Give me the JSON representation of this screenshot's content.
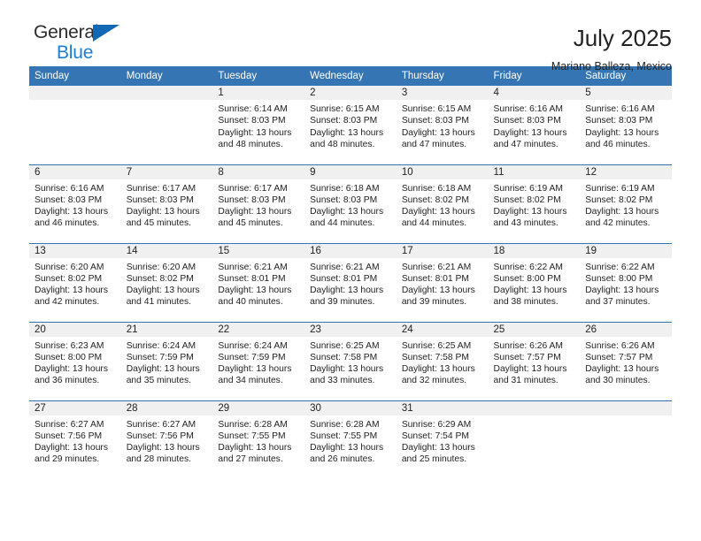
{
  "brand": {
    "name_top": "General",
    "name_bottom": "Blue",
    "triangle_icon": "blue-triangle-icon",
    "color_dark": "#2b2b2b",
    "color_blue": "#1b7fd4"
  },
  "header": {
    "title": "July 2025",
    "subtitle": "Mariano Balleza, Mexico"
  },
  "theme": {
    "header_blue": "#3575b4",
    "daynum_gray": "#f0f0f0",
    "text": "#222222"
  },
  "calendar": {
    "columns": [
      "Sunday",
      "Monday",
      "Tuesday",
      "Wednesday",
      "Thursday",
      "Friday",
      "Saturday"
    ],
    "weeks": [
      [
        {
          "day": "",
          "empty": true,
          "sunrise": "",
          "sunset": "",
          "daylight_1": "",
          "daylight_2": ""
        },
        {
          "day": "",
          "empty": true,
          "sunrise": "",
          "sunset": "",
          "daylight_1": "",
          "daylight_2": ""
        },
        {
          "day": "1",
          "empty": false,
          "sunrise": "Sunrise: 6:14 AM",
          "sunset": "Sunset: 8:03 PM",
          "daylight_1": "Daylight: 13 hours",
          "daylight_2": "and 48 minutes."
        },
        {
          "day": "2",
          "empty": false,
          "sunrise": "Sunrise: 6:15 AM",
          "sunset": "Sunset: 8:03 PM",
          "daylight_1": "Daylight: 13 hours",
          "daylight_2": "and 48 minutes."
        },
        {
          "day": "3",
          "empty": false,
          "sunrise": "Sunrise: 6:15 AM",
          "sunset": "Sunset: 8:03 PM",
          "daylight_1": "Daylight: 13 hours",
          "daylight_2": "and 47 minutes."
        },
        {
          "day": "4",
          "empty": false,
          "sunrise": "Sunrise: 6:16 AM",
          "sunset": "Sunset: 8:03 PM",
          "daylight_1": "Daylight: 13 hours",
          "daylight_2": "and 47 minutes."
        },
        {
          "day": "5",
          "empty": false,
          "sunrise": "Sunrise: 6:16 AM",
          "sunset": "Sunset: 8:03 PM",
          "daylight_1": "Daylight: 13 hours",
          "daylight_2": "and 46 minutes."
        }
      ],
      [
        {
          "day": "6",
          "empty": false,
          "sunrise": "Sunrise: 6:16 AM",
          "sunset": "Sunset: 8:03 PM",
          "daylight_1": "Daylight: 13 hours",
          "daylight_2": "and 46 minutes."
        },
        {
          "day": "7",
          "empty": false,
          "sunrise": "Sunrise: 6:17 AM",
          "sunset": "Sunset: 8:03 PM",
          "daylight_1": "Daylight: 13 hours",
          "daylight_2": "and 45 minutes."
        },
        {
          "day": "8",
          "empty": false,
          "sunrise": "Sunrise: 6:17 AM",
          "sunset": "Sunset: 8:03 PM",
          "daylight_1": "Daylight: 13 hours",
          "daylight_2": "and 45 minutes."
        },
        {
          "day": "9",
          "empty": false,
          "sunrise": "Sunrise: 6:18 AM",
          "sunset": "Sunset: 8:03 PM",
          "daylight_1": "Daylight: 13 hours",
          "daylight_2": "and 44 minutes."
        },
        {
          "day": "10",
          "empty": false,
          "sunrise": "Sunrise: 6:18 AM",
          "sunset": "Sunset: 8:02 PM",
          "daylight_1": "Daylight: 13 hours",
          "daylight_2": "and 44 minutes."
        },
        {
          "day": "11",
          "empty": false,
          "sunrise": "Sunrise: 6:19 AM",
          "sunset": "Sunset: 8:02 PM",
          "daylight_1": "Daylight: 13 hours",
          "daylight_2": "and 43 minutes."
        },
        {
          "day": "12",
          "empty": false,
          "sunrise": "Sunrise: 6:19 AM",
          "sunset": "Sunset: 8:02 PM",
          "daylight_1": "Daylight: 13 hours",
          "daylight_2": "and 42 minutes."
        }
      ],
      [
        {
          "day": "13",
          "empty": false,
          "sunrise": "Sunrise: 6:20 AM",
          "sunset": "Sunset: 8:02 PM",
          "daylight_1": "Daylight: 13 hours",
          "daylight_2": "and 42 minutes."
        },
        {
          "day": "14",
          "empty": false,
          "sunrise": "Sunrise: 6:20 AM",
          "sunset": "Sunset: 8:02 PM",
          "daylight_1": "Daylight: 13 hours",
          "daylight_2": "and 41 minutes."
        },
        {
          "day": "15",
          "empty": false,
          "sunrise": "Sunrise: 6:21 AM",
          "sunset": "Sunset: 8:01 PM",
          "daylight_1": "Daylight: 13 hours",
          "daylight_2": "and 40 minutes."
        },
        {
          "day": "16",
          "empty": false,
          "sunrise": "Sunrise: 6:21 AM",
          "sunset": "Sunset: 8:01 PM",
          "daylight_1": "Daylight: 13 hours",
          "daylight_2": "and 39 minutes."
        },
        {
          "day": "17",
          "empty": false,
          "sunrise": "Sunrise: 6:21 AM",
          "sunset": "Sunset: 8:01 PM",
          "daylight_1": "Daylight: 13 hours",
          "daylight_2": "and 39 minutes."
        },
        {
          "day": "18",
          "empty": false,
          "sunrise": "Sunrise: 6:22 AM",
          "sunset": "Sunset: 8:00 PM",
          "daylight_1": "Daylight: 13 hours",
          "daylight_2": "and 38 minutes."
        },
        {
          "day": "19",
          "empty": false,
          "sunrise": "Sunrise: 6:22 AM",
          "sunset": "Sunset: 8:00 PM",
          "daylight_1": "Daylight: 13 hours",
          "daylight_2": "and 37 minutes."
        }
      ],
      [
        {
          "day": "20",
          "empty": false,
          "sunrise": "Sunrise: 6:23 AM",
          "sunset": "Sunset: 8:00 PM",
          "daylight_1": "Daylight: 13 hours",
          "daylight_2": "and 36 minutes."
        },
        {
          "day": "21",
          "empty": false,
          "sunrise": "Sunrise: 6:24 AM",
          "sunset": "Sunset: 7:59 PM",
          "daylight_1": "Daylight: 13 hours",
          "daylight_2": "and 35 minutes."
        },
        {
          "day": "22",
          "empty": false,
          "sunrise": "Sunrise: 6:24 AM",
          "sunset": "Sunset: 7:59 PM",
          "daylight_1": "Daylight: 13 hours",
          "daylight_2": "and 34 minutes."
        },
        {
          "day": "23",
          "empty": false,
          "sunrise": "Sunrise: 6:25 AM",
          "sunset": "Sunset: 7:58 PM",
          "daylight_1": "Daylight: 13 hours",
          "daylight_2": "and 33 minutes."
        },
        {
          "day": "24",
          "empty": false,
          "sunrise": "Sunrise: 6:25 AM",
          "sunset": "Sunset: 7:58 PM",
          "daylight_1": "Daylight: 13 hours",
          "daylight_2": "and 32 minutes."
        },
        {
          "day": "25",
          "empty": false,
          "sunrise": "Sunrise: 6:26 AM",
          "sunset": "Sunset: 7:57 PM",
          "daylight_1": "Daylight: 13 hours",
          "daylight_2": "and 31 minutes."
        },
        {
          "day": "26",
          "empty": false,
          "sunrise": "Sunrise: 6:26 AM",
          "sunset": "Sunset: 7:57 PM",
          "daylight_1": "Daylight: 13 hours",
          "daylight_2": "and 30 minutes."
        }
      ],
      [
        {
          "day": "27",
          "empty": false,
          "sunrise": "Sunrise: 6:27 AM",
          "sunset": "Sunset: 7:56 PM",
          "daylight_1": "Daylight: 13 hours",
          "daylight_2": "and 29 minutes."
        },
        {
          "day": "28",
          "empty": false,
          "sunrise": "Sunrise: 6:27 AM",
          "sunset": "Sunset: 7:56 PM",
          "daylight_1": "Daylight: 13 hours",
          "daylight_2": "and 28 minutes."
        },
        {
          "day": "29",
          "empty": false,
          "sunrise": "Sunrise: 6:28 AM",
          "sunset": "Sunset: 7:55 PM",
          "daylight_1": "Daylight: 13 hours",
          "daylight_2": "and 27 minutes."
        },
        {
          "day": "30",
          "empty": false,
          "sunrise": "Sunrise: 6:28 AM",
          "sunset": "Sunset: 7:55 PM",
          "daylight_1": "Daylight: 13 hours",
          "daylight_2": "and 26 minutes."
        },
        {
          "day": "31",
          "empty": false,
          "sunrise": "Sunrise: 6:29 AM",
          "sunset": "Sunset: 7:54 PM",
          "daylight_1": "Daylight: 13 hours",
          "daylight_2": "and 25 minutes."
        },
        {
          "day": "",
          "empty": true,
          "sunrise": "",
          "sunset": "",
          "daylight_1": "",
          "daylight_2": ""
        },
        {
          "day": "",
          "empty": true,
          "sunrise": "",
          "sunset": "",
          "daylight_1": "",
          "daylight_2": ""
        }
      ]
    ]
  }
}
